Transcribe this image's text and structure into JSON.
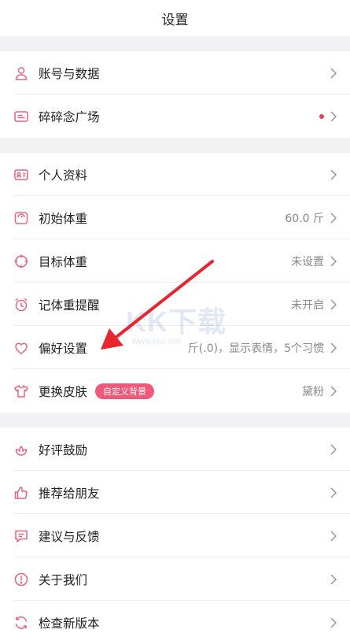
{
  "header": {
    "title": "设置"
  },
  "sections": [
    {
      "rows": [
        {
          "label": "账号与数据"
        },
        {
          "label": "碎碎念广场"
        }
      ]
    },
    {
      "rows": [
        {
          "label": "个人资料"
        },
        {
          "label": "初始体重",
          "value": "60.0 斤"
        },
        {
          "label": "目标体重",
          "value": "未设置"
        },
        {
          "label": "记体重提醒",
          "value": "未开启"
        },
        {
          "label": "偏好设置",
          "value": "斤(.0)，显示表情，5个习惯"
        },
        {
          "label": "更换皮肤",
          "badge": "自定义背景",
          "value": "黛粉"
        }
      ]
    },
    {
      "rows": [
        {
          "label": "好评鼓励"
        },
        {
          "label": "推荐给朋友"
        },
        {
          "label": "建议与反馈"
        },
        {
          "label": "关于我们"
        },
        {
          "label": "检查新版本"
        }
      ]
    }
  ],
  "watermark": {
    "main": "KK下载",
    "sub": "www.kkx.net"
  },
  "colors": {
    "accent": "#f0597a",
    "icon": "#e8637e",
    "dot": "#ef3b52",
    "arrow": "#e8252f"
  }
}
